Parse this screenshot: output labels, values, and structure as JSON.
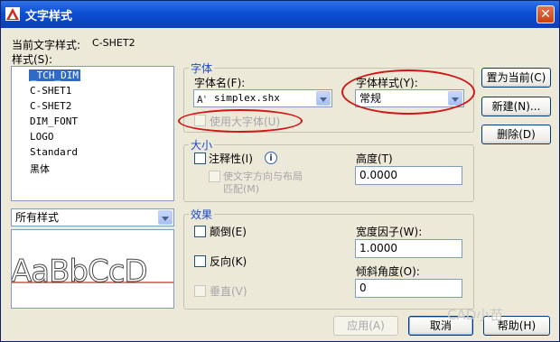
{
  "window": {
    "title": "文字样式",
    "close_glyph": "✕"
  },
  "current_style": {
    "label": "当前文字样式:",
    "value": "C-SHET2"
  },
  "styles": {
    "label": "样式(S):",
    "items": [
      "_TCH_DIM",
      "C-SHET1",
      "C-SHET2",
      "DIM_FONT",
      "LOGO",
      "Standard",
      "黑体"
    ],
    "selected_index": 0
  },
  "filter": {
    "value": "所有样式"
  },
  "preview": {
    "text": "AaBbCcD"
  },
  "font_group": {
    "title": "字体",
    "font_name_label": "字体名(F):",
    "font_name_value": "simplex.shx",
    "font_icon": "shx-font-icon",
    "font_style_label": "字体样式(Y):",
    "font_style_value": "常规",
    "use_bigfont_label": "使用大字体(U)"
  },
  "size_group": {
    "title": "大小",
    "annotative_label": "注释性(I)",
    "info_glyph": "i",
    "match_orientation_line1": "使文字方向与布局",
    "match_orientation_line2": "匹配(M)",
    "height_label": "高度(T)",
    "height_value": "0.0000"
  },
  "effects_group": {
    "title": "效果",
    "upside_down_label": "颠倒(E)",
    "backwards_label": "反向(K)",
    "vertical_label": "垂直(V)",
    "width_factor_label": "宽度因子(W):",
    "width_factor_value": "1.0000",
    "oblique_label": "倾斜角度(O):",
    "oblique_value": "0"
  },
  "buttons": {
    "set_current": "置为当前(C)",
    "new": "新建(N)...",
    "delete": "删除(D)",
    "apply": "应用(A)",
    "cancel": "取消",
    "help": "帮助(H)"
  },
  "watermark": "CAD小苗",
  "colors": {
    "title_bar": "#0c4fd4",
    "annotation_red": "#d01717",
    "selection": "#316ac5",
    "group_title": "#1d48c8"
  }
}
